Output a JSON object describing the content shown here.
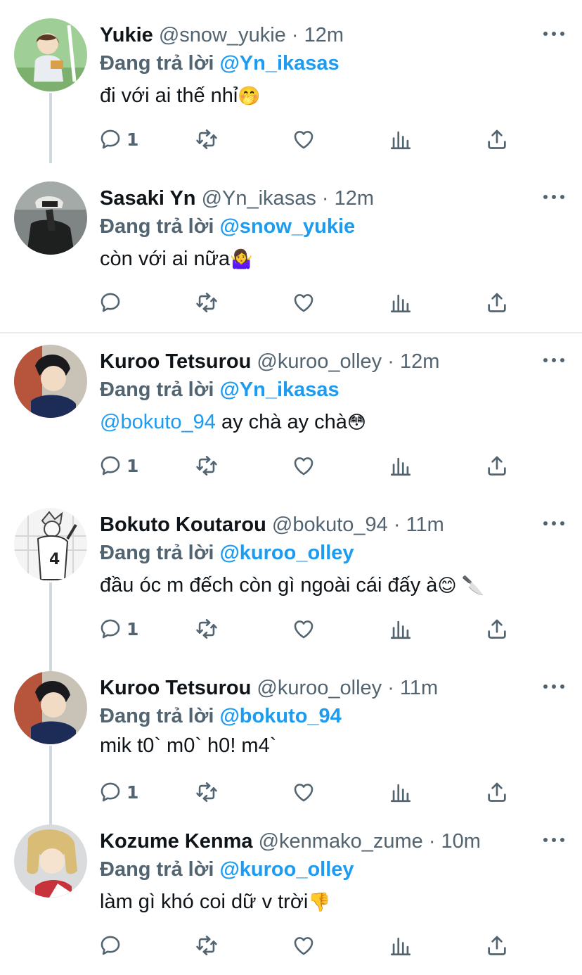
{
  "labels": {
    "replying_to": "Đang trả lời"
  },
  "colors": {
    "accent": "#1d9bf0",
    "muted": "#536471",
    "text": "#0f1419",
    "thread": "#cfd9de"
  },
  "tweets": [
    {
      "name": "Yukie",
      "handle": "@snow_yukie",
      "sep": " · ",
      "time": "12m",
      "reply_to": "@Yn_ikasas",
      "text_mention": "",
      "text": "đi với ai thế nhỉ",
      "emoji": "🤭",
      "reply_count": "1",
      "avatar": "avatar-yukie"
    },
    {
      "name": "Sasaki Yn",
      "handle": "@Yn_ikasas",
      "sep": " · ",
      "time": "12m",
      "reply_to": "@snow_yukie",
      "text_mention": "",
      "text": "còn với ai nữa",
      "emoji": "🤷‍♀️",
      "reply_count": "",
      "avatar": "avatar-sasaki"
    },
    {
      "name": "Kuroo Tetsurou",
      "handle": "@kuroo_olley",
      "sep": " · ",
      "time": "12m",
      "reply_to": "@Yn_ikasas",
      "text_mention": "@bokuto_94",
      "text": " ay chà ay chà",
      "emoji": "😳",
      "reply_count": "1",
      "avatar": "avatar-kuroo"
    },
    {
      "name": "Bokuto Koutarou",
      "handle": " @bokuto_94",
      "sep": " · ",
      "time": "11m",
      "reply_to": "@kuroo_olley",
      "text_mention": "",
      "text": "đầu óc m đếch còn gì ngoài cái đấy à",
      "emoji": "😊 🔪",
      "reply_count": "1",
      "avatar": "avatar-bokuto"
    },
    {
      "name": "Kuroo Tetsurou",
      "handle": "@kuroo_olley",
      "sep": " · ",
      "time": "11m",
      "reply_to": "@bokuto_94",
      "text_mention": "",
      "text": "mik t0` m0` h0! m4`",
      "emoji": "",
      "reply_count": "1",
      "avatar": "avatar-kuroo"
    },
    {
      "name": "Kozume Kenma",
      "handle": "@kenmako_zume",
      "sep": " · ",
      "time": "10m",
      "reply_to": "@kuroo_olley",
      "text_mention": "",
      "text": "làm gì khó coi dữ v trời",
      "emoji": "👎",
      "reply_count": "",
      "avatar": "avatar-kenma"
    }
  ]
}
